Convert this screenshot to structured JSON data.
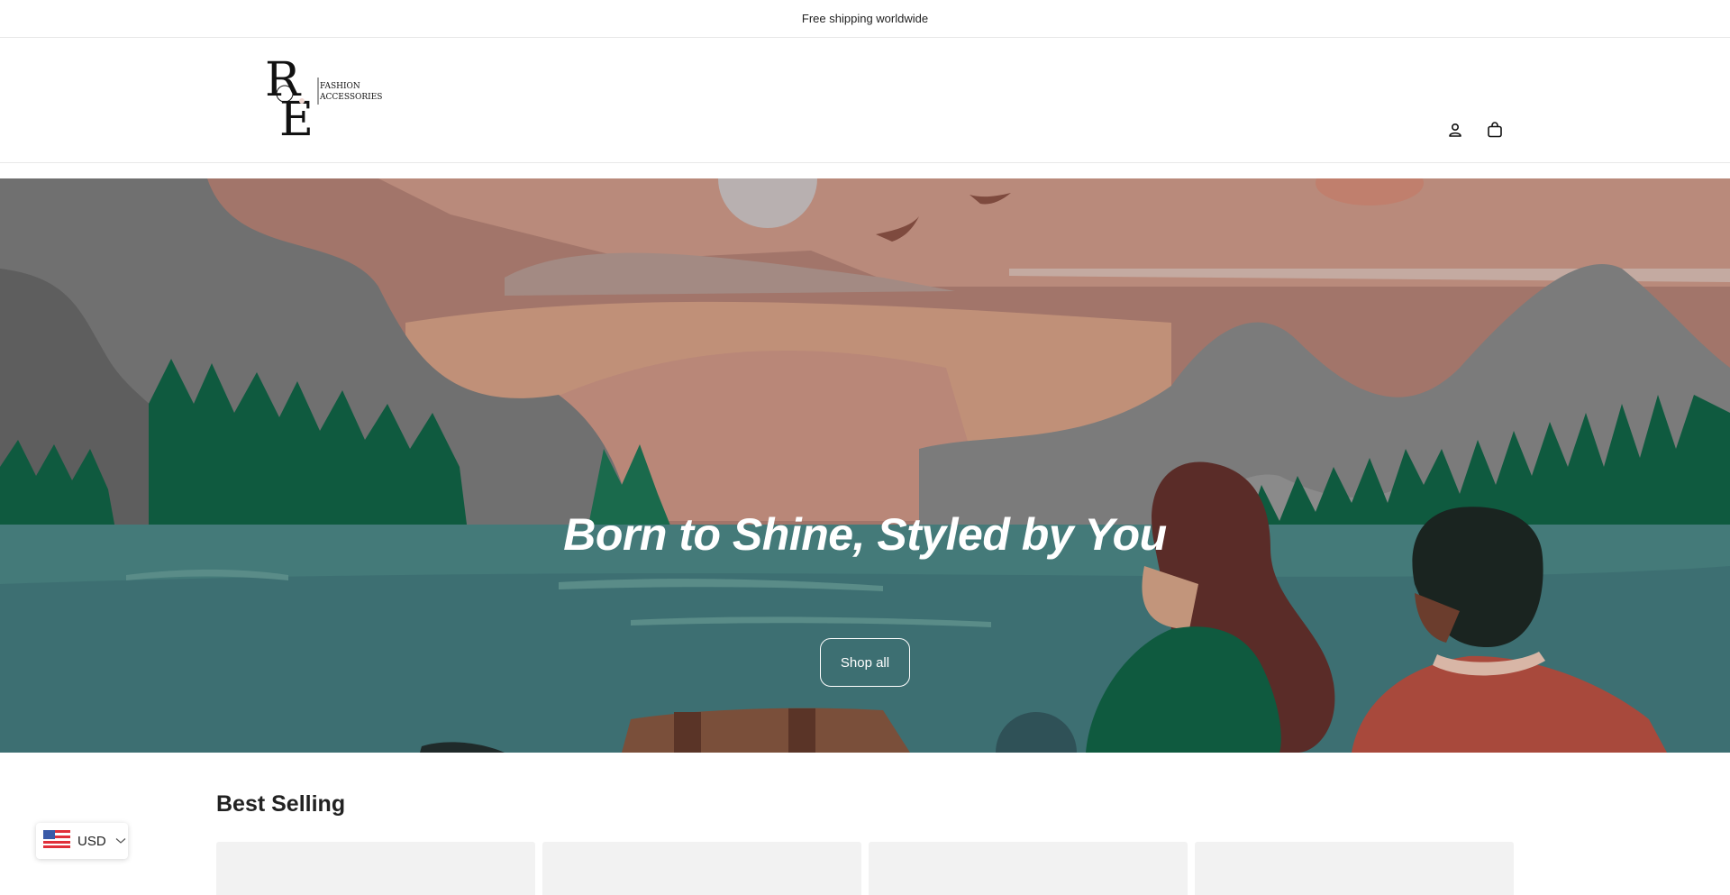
{
  "announcement": {
    "text": "Free shipping worldwide"
  },
  "header": {
    "logo_letters": "RE",
    "logo_text_line1": "FASHION",
    "logo_text_line2": "ACCESSORIES",
    "account_icon": "account-icon",
    "cart_icon": "cart-icon"
  },
  "hero": {
    "title": "Born to Shine, Styled by You",
    "button_label": "Shop all"
  },
  "best_selling": {
    "title": "Best Selling",
    "product_count": 4
  },
  "currency": {
    "flag_icon": "us-flag-icon",
    "code": "USD",
    "chevron_icon": "chevron-down-icon"
  }
}
